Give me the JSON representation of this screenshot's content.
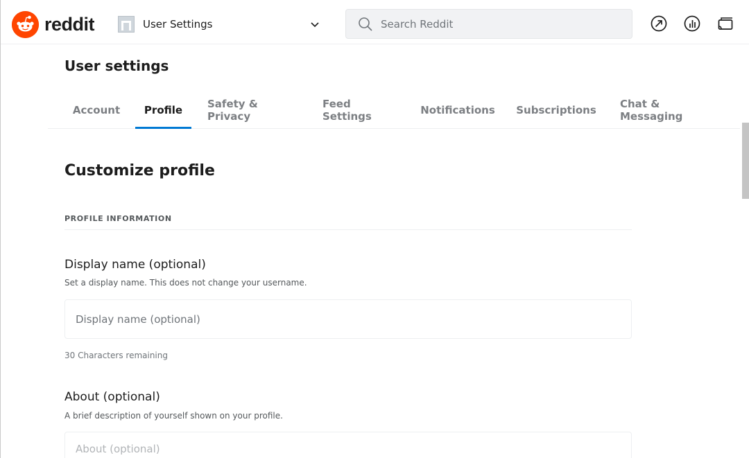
{
  "header": {
    "logo_text": "reddit",
    "community_label": "User Settings",
    "search_placeholder": "Search Reddit",
    "icons": [
      "popular-icon",
      "coins-icon",
      "coins-icon"
    ]
  },
  "page": {
    "title": "User settings"
  },
  "tabs": [
    {
      "label": "Account",
      "active": false
    },
    {
      "label": "Profile",
      "active": true
    },
    {
      "label": "Safety & Privacy",
      "active": false
    },
    {
      "label": "Feed Settings",
      "active": false
    },
    {
      "label": "Notifications",
      "active": false
    },
    {
      "label": "Subscriptions",
      "active": false
    },
    {
      "label": "Chat & Messaging",
      "active": false
    }
  ],
  "content": {
    "section_title": "Customize profile",
    "section_label": "PROFILE INFORMATION",
    "display_name": {
      "title": "Display name (optional)",
      "description": "Set a display name. This does not change your username.",
      "placeholder": "Display name (optional)",
      "counter": "30 Characters remaining"
    },
    "about": {
      "title": "About (optional)",
      "description": "A brief description of yourself shown on your profile.",
      "placeholder": "About (optional)"
    }
  },
  "colors": {
    "brand": "#ff4500",
    "active_tab": "#0079d3"
  }
}
